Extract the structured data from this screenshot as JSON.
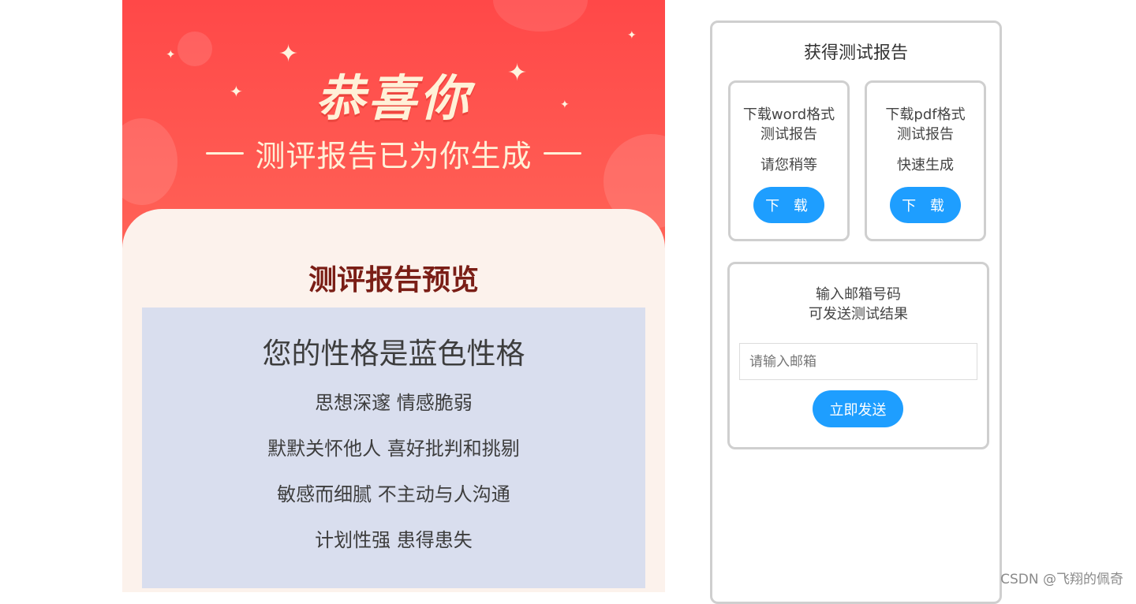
{
  "banner": {
    "congrats": "恭喜你",
    "subtitle": "测评报告已为你生成",
    "colors": {
      "top": "#ff4848",
      "bottom": "#ff9477",
      "text": "#fff1d8"
    }
  },
  "preview": {
    "title": "测评报告预览",
    "headline": "您的性格是蓝色性格",
    "lines": [
      "思想深邃 情感脆弱",
      "默默关怀他人 喜好批判和挑剔",
      "敏感而细腻 不主动与人沟通",
      "计划性强 患得患失"
    ]
  },
  "report": {
    "title": "获得测试报告",
    "word": {
      "name_line1": "下载word格式",
      "name_line2": "测试报告",
      "status": "请您稍等",
      "button": "下 载"
    },
    "pdf": {
      "name_line1": "下载pdf格式",
      "name_line2": "测试报告",
      "status": "快速生成",
      "button": "下 载"
    },
    "email": {
      "line1": "输入邮箱号码",
      "line2": "可发送测试结果",
      "placeholder": "请输入邮箱",
      "value": "",
      "button": "立即发送"
    },
    "accent": "#1e9eff"
  },
  "watermark": "CSDN @飞翔的佩奇"
}
